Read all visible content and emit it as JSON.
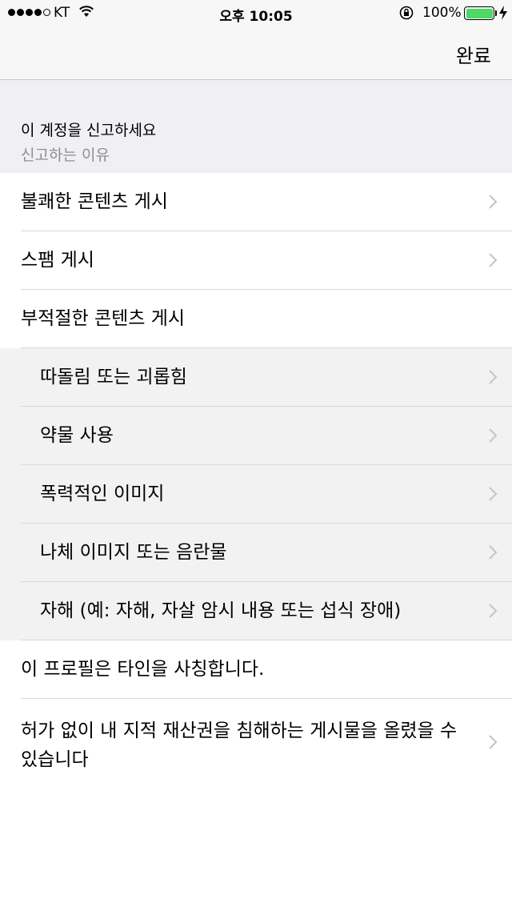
{
  "status_bar": {
    "carrier": "KT",
    "time": "오후 10:05",
    "battery_percent": "100%",
    "signal_bars_filled": 4,
    "signal_bars_total": 5,
    "battery_level": 1.0,
    "icons": [
      "wifi-icon",
      "rotation-lock-icon",
      "battery-icon",
      "charging-icon"
    ],
    "battery_color": "#4cd964"
  },
  "nav": {
    "done_label": "완료"
  },
  "header": {
    "title": "이 계정을 신고하세요",
    "subtitle": "신고하는 이유"
  },
  "rows": [
    {
      "label": "불쾌한 콘텐츠 게시",
      "chevron": true
    },
    {
      "label": "스팸 게시",
      "chevron": true
    },
    {
      "label": "부적절한 콘텐츠 게시",
      "chevron": false
    },
    {
      "label": "따돌림 또는 괴롭힘",
      "chevron": true
    },
    {
      "label": "약물 사용",
      "chevron": true
    },
    {
      "label": "폭력적인 이미지",
      "chevron": true
    },
    {
      "label": "나체 이미지 또는 음란물",
      "chevron": true
    },
    {
      "label": "자해 (예: 자해, 자살 암시 내용 또는 섭식 장애)",
      "chevron": true
    },
    {
      "label": "이 프로필은 타인을 사칭합니다.",
      "chevron": false
    },
    {
      "label": "허가 없이 내 지적 재산권을 침해하는 게시물을 올렸을 수 있습니다",
      "chevron": true
    }
  ],
  "colors": {
    "header_bg": "#efeff4",
    "subtitle": "#8e8e93",
    "sub_row_bg": "#f2f2f2",
    "chevron": "#c7c7cc"
  }
}
